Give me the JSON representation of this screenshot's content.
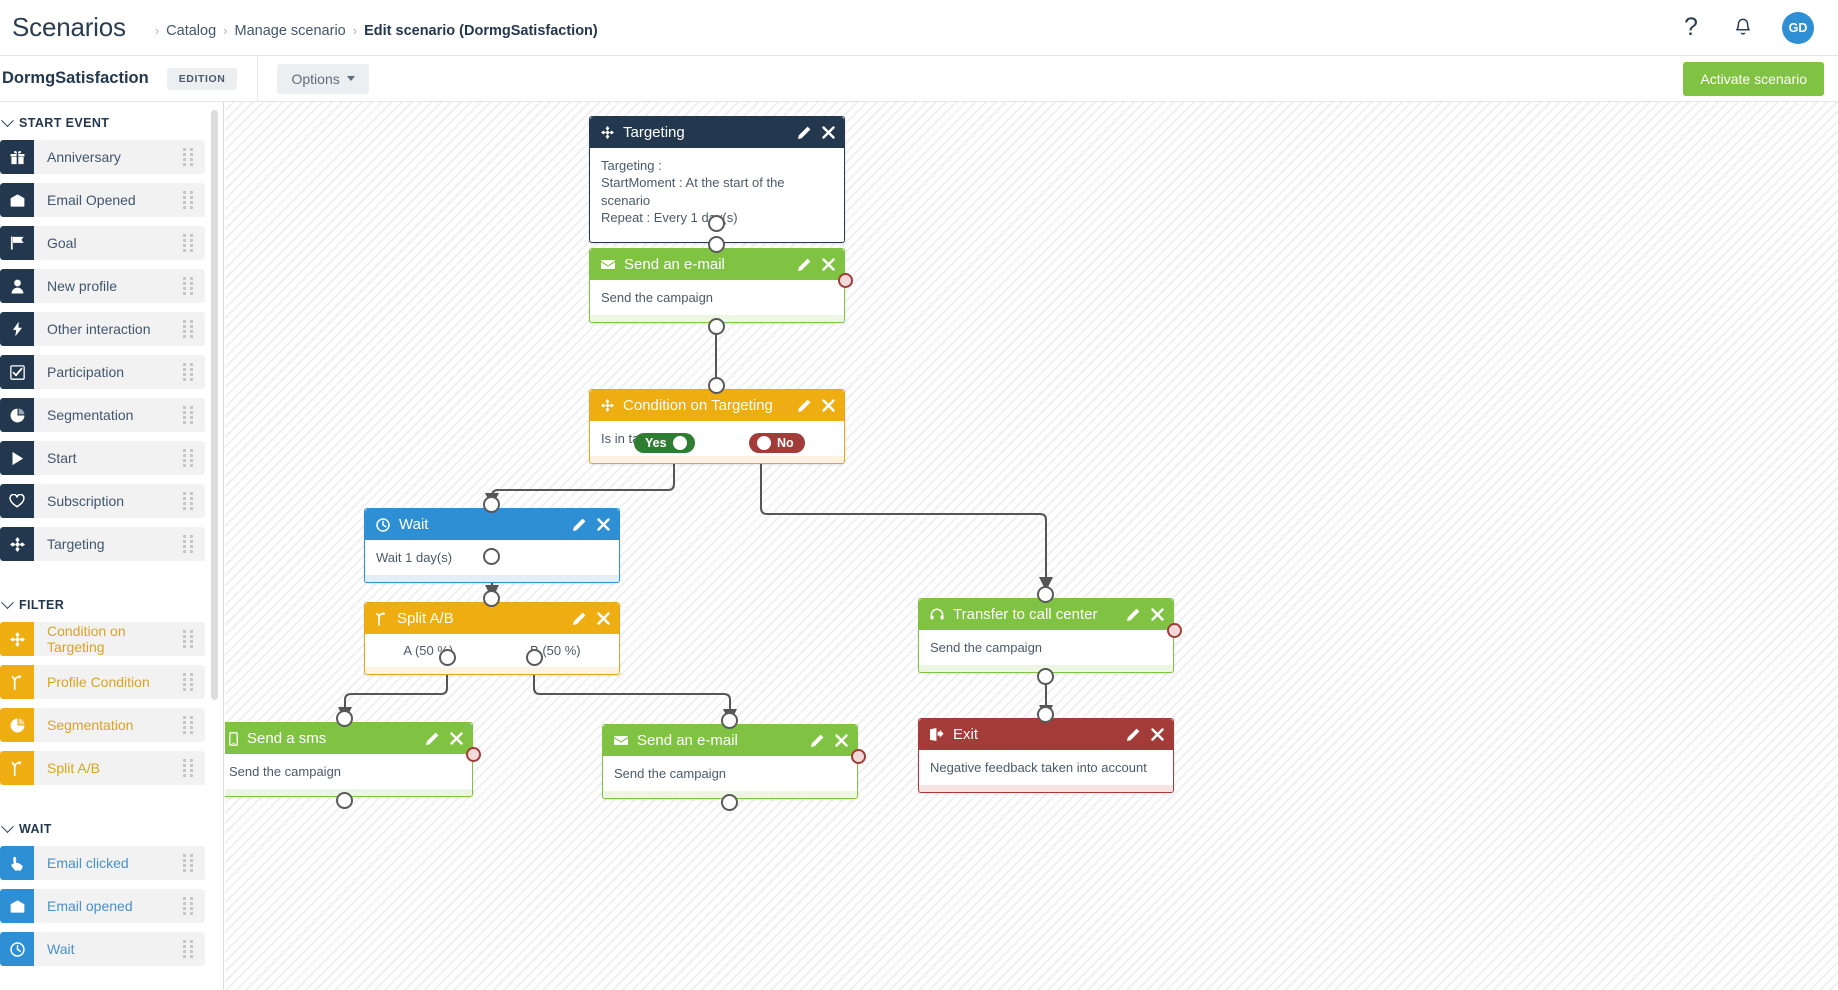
{
  "header": {
    "page_title": "Scenarios",
    "breadcrumb": [
      {
        "label": "Catalog",
        "current": false
      },
      {
        "label": "Manage scenario",
        "current": false
      },
      {
        "label": "Edit scenario (DormgSatisfaction)",
        "current": true
      }
    ],
    "help_icon": "question-mark-icon",
    "notification_icon": "bell-icon",
    "avatar_initials": "GD"
  },
  "subbar": {
    "scenario_name": "DormgSatisfaction",
    "edition_badge": "EDITION",
    "options_label": "Options",
    "activate_label": "Activate scenario"
  },
  "sidebar": {
    "groups": [
      {
        "title": "START EVENT",
        "kind": "start",
        "items": [
          {
            "label": "Anniversary",
            "icon": "gift-icon"
          },
          {
            "label": "Email Opened",
            "icon": "envelope-open-icon"
          },
          {
            "label": "Goal",
            "icon": "flag-icon"
          },
          {
            "label": "New profile",
            "icon": "user-icon"
          },
          {
            "label": "Other interaction",
            "icon": "bolt-icon"
          },
          {
            "label": "Participation",
            "icon": "check-square-icon"
          },
          {
            "label": "Segmentation",
            "icon": "pie-chart-icon"
          },
          {
            "label": "Start",
            "icon": "play-icon"
          },
          {
            "label": "Subscription",
            "icon": "heart-icon"
          },
          {
            "label": "Targeting",
            "icon": "crosshair-icon"
          }
        ]
      },
      {
        "title": "FILTER",
        "kind": "filter",
        "items": [
          {
            "label": "Condition on Targeting",
            "icon": "crosshair-icon"
          },
          {
            "label": "Profile Condition",
            "icon": "split-icon"
          },
          {
            "label": "Segmentation",
            "icon": "pie-chart-icon"
          },
          {
            "label": "Split A/B",
            "icon": "split-icon"
          }
        ]
      },
      {
        "title": "WAIT",
        "kind": "wait",
        "items": [
          {
            "label": "Email clicked",
            "icon": "click-hand-icon"
          },
          {
            "label": "Email opened",
            "icon": "envelope-open-icon"
          },
          {
            "label": "Wait",
            "icon": "clock-icon"
          }
        ]
      }
    ]
  },
  "canvas": {
    "nodes": {
      "targeting": {
        "title": "Targeting",
        "icon": "crosshair-icon",
        "body_lines": [
          "Targeting :",
          "StartMoment : At the start of the scenario",
          "Repeat : Every 1 day(s)"
        ]
      },
      "email1": {
        "title": "Send an e-mail",
        "icon": "envelope-icon",
        "body": "Send the campaign"
      },
      "condition": {
        "title": "Condition on Targeting",
        "icon": "crosshair-icon",
        "body": "Is in targeting ?",
        "yes_label": "Yes",
        "no_label": "No"
      },
      "wait": {
        "title": "Wait",
        "icon": "clock-icon",
        "body": "Wait 1 day(s)"
      },
      "split": {
        "title": "Split A/B",
        "icon": "split-icon",
        "branch_a": "A (50 %)",
        "branch_b": "B (50 %)"
      },
      "sms": {
        "title": "Send a sms",
        "icon": "mobile-icon",
        "body": "Send the campaign"
      },
      "email2": {
        "title": "Send an e-mail",
        "icon": "envelope-icon",
        "body": "Send the campaign"
      },
      "callcenter": {
        "title": "Transfer to call center",
        "icon": "headset-icon",
        "body": "Send the campaign"
      },
      "exit": {
        "title": "Exit",
        "icon": "exit-door-icon",
        "body": "Negative feedback taken into account"
      }
    },
    "edit_icon": "pencil-icon",
    "delete_icon": "close-x-icon"
  },
  "colors": {
    "navy": "#23384f",
    "green": "#80c342",
    "orange": "#eead10",
    "blue": "#2e8fd4",
    "red": "#a33c38",
    "yes_green": "#2f7d32"
  }
}
